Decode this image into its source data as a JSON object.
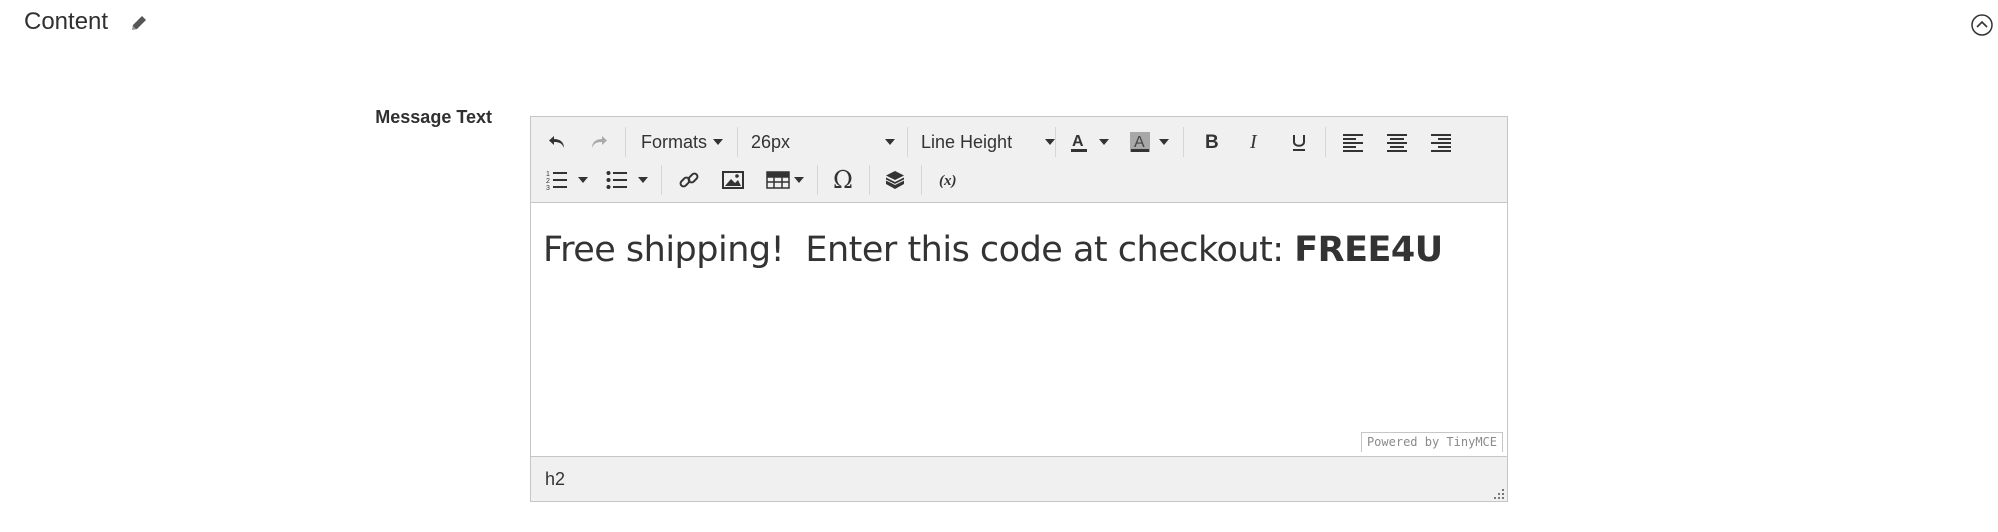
{
  "section": {
    "title": "Content"
  },
  "field": {
    "label": "Message Text"
  },
  "toolbar": {
    "formats_label": "Formats",
    "font_size": "26px",
    "line_height_label": "Line Height"
  },
  "editor": {
    "text_plain": "Free shipping!  Enter this code at checkout: ",
    "text_bold": "FREE4U",
    "powered_by": "Powered by TinyMCE",
    "path": "h2"
  },
  "icons": [
    "pencil-icon",
    "collapse-circle-icon",
    "undo-icon",
    "redo-icon",
    "text-color-icon",
    "background-color-icon",
    "bold-icon",
    "italic-icon",
    "underline-icon",
    "align-left-icon",
    "align-center-icon",
    "align-right-icon",
    "numbered-list-icon",
    "bullet-list-icon",
    "link-icon",
    "image-icon",
    "table-icon",
    "omega-icon",
    "widget-icon",
    "variable-icon"
  ],
  "colors": {
    "toolbar_bg": "#f0f0f0",
    "border": "#c6c6c6",
    "text": "#333333"
  }
}
